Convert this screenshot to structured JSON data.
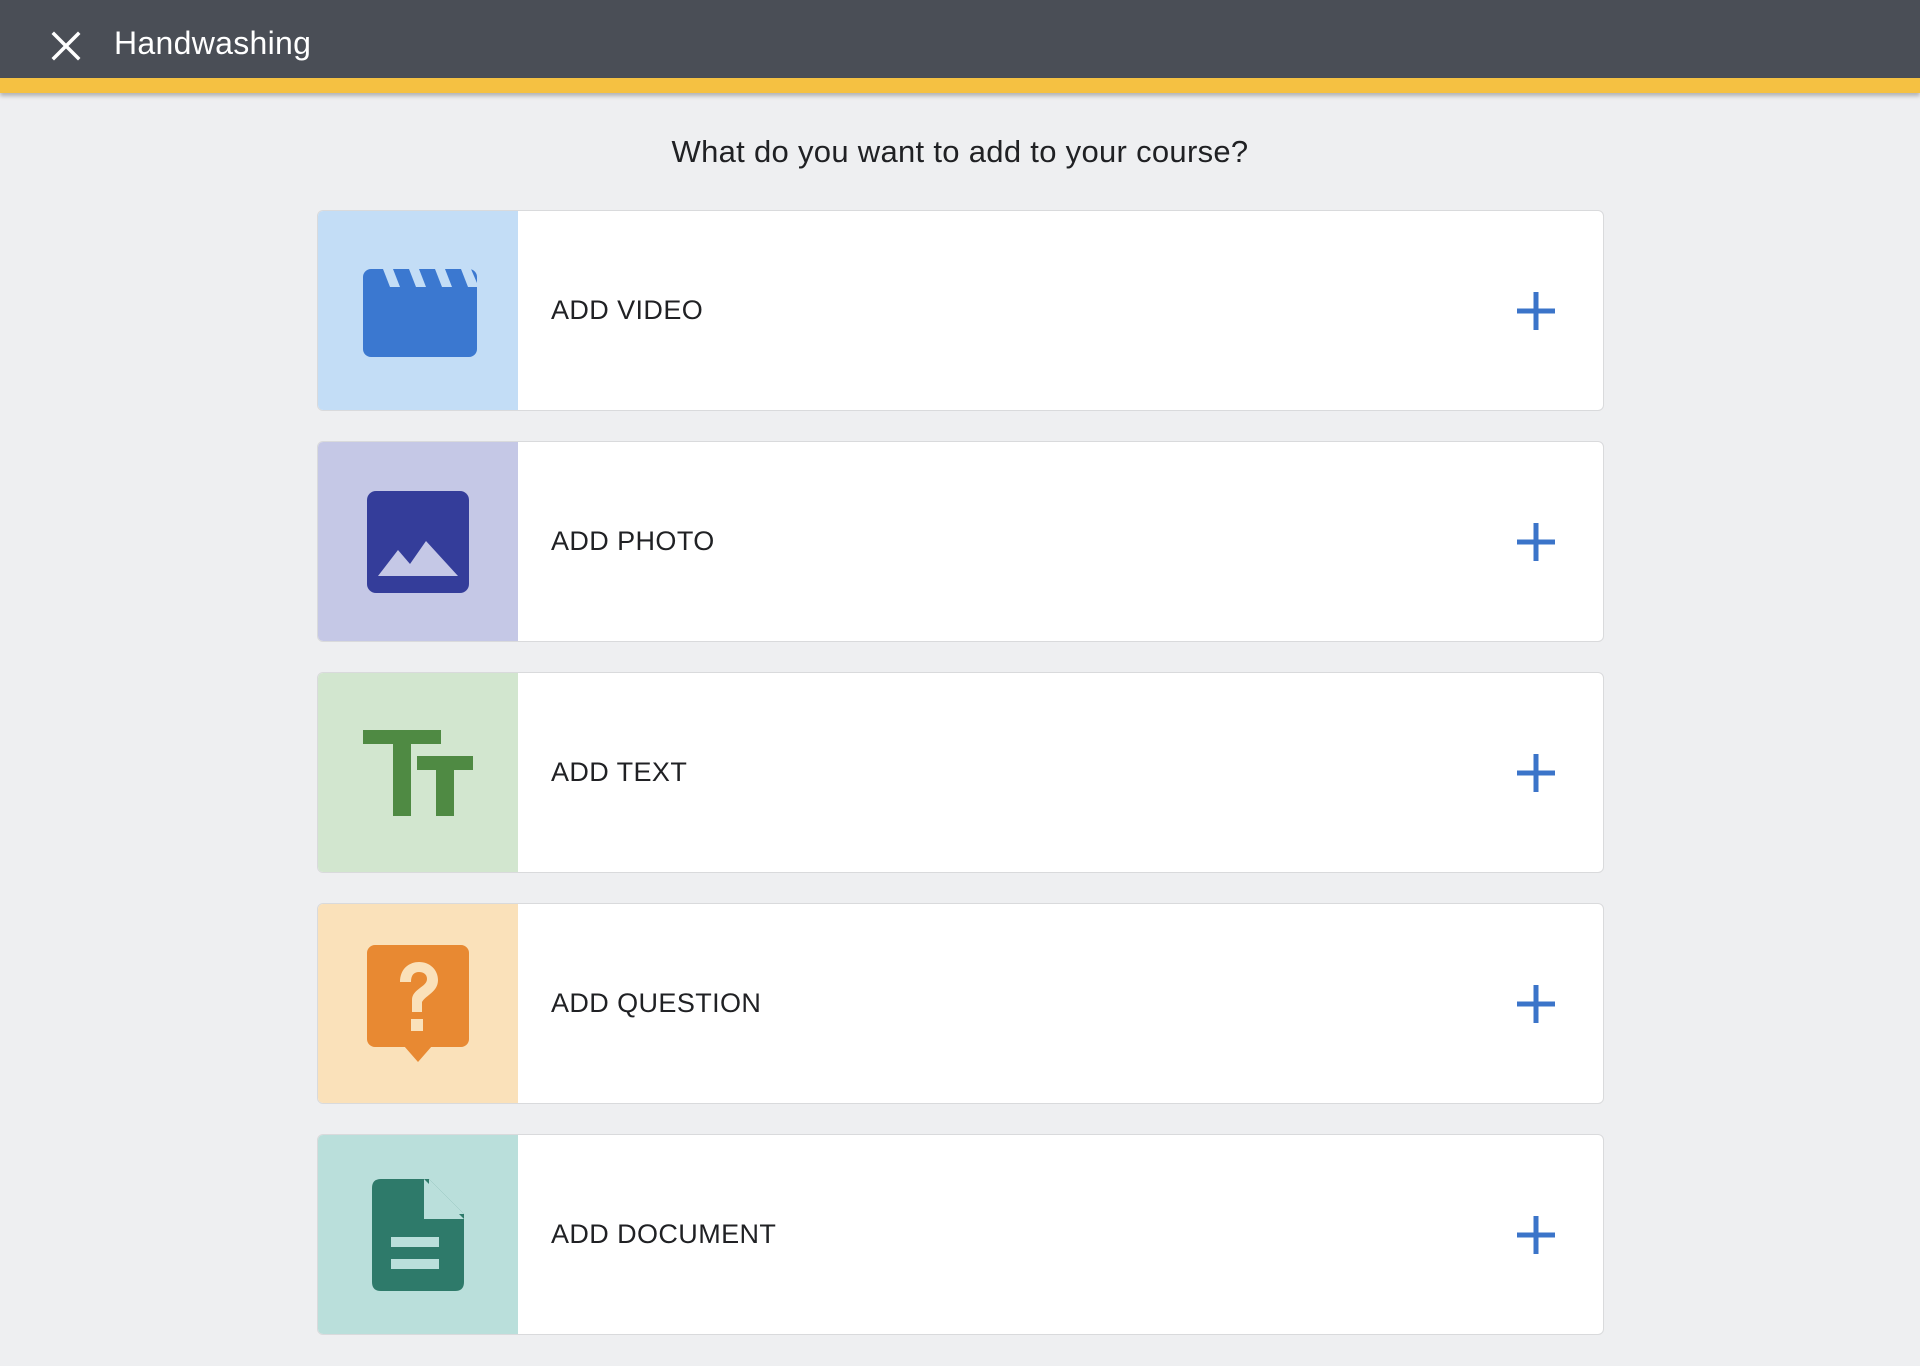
{
  "header": {
    "title": "Handwashing",
    "close_icon": "close-icon",
    "background_color": "#4a4e56",
    "accent_color": "#f5c142"
  },
  "prompt": "What do you want to add to your course?",
  "options": [
    {
      "label": "ADD VIDEO",
      "icon": "video-clapperboard-icon",
      "panel_color": "#c3ddf6",
      "icon_color": "#3b78d0"
    },
    {
      "label": "ADD PHOTO",
      "icon": "photo-icon",
      "panel_color": "#c5c8e6",
      "icon_color": "#343d9a"
    },
    {
      "label": "ADD TEXT",
      "icon": "text-icon",
      "panel_color": "#d2e6cf",
      "icon_color": "#4f8a43"
    },
    {
      "label": "ADD QUESTION",
      "icon": "question-icon",
      "panel_color": "#fae1ba",
      "icon_color": "#e88932"
    },
    {
      "label": "ADD DOCUMENT",
      "icon": "document-icon",
      "panel_color": "#badfdb",
      "icon_color": "#2e7a6a"
    }
  ],
  "plus_icon": "plus-icon",
  "plus_color": "#3b74c9"
}
